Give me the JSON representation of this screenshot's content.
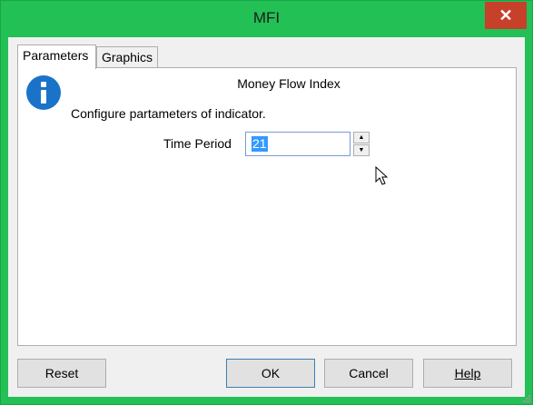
{
  "window": {
    "title": "MFI",
    "close_glyph": "✕",
    "frame_color": "#22c055",
    "close_color": "#c7402a"
  },
  "tabs": [
    {
      "label": "Parameters",
      "active": true
    },
    {
      "label": "Graphics",
      "active": false
    }
  ],
  "panel": {
    "title": "Money Flow Index",
    "description": "Configure partameters of indicator.",
    "icon": "info-icon",
    "time_period": {
      "label": "Time Period",
      "value": "21"
    }
  },
  "buttons": {
    "reset": "Reset",
    "ok": "OK",
    "cancel": "Cancel",
    "help": "Help"
  }
}
